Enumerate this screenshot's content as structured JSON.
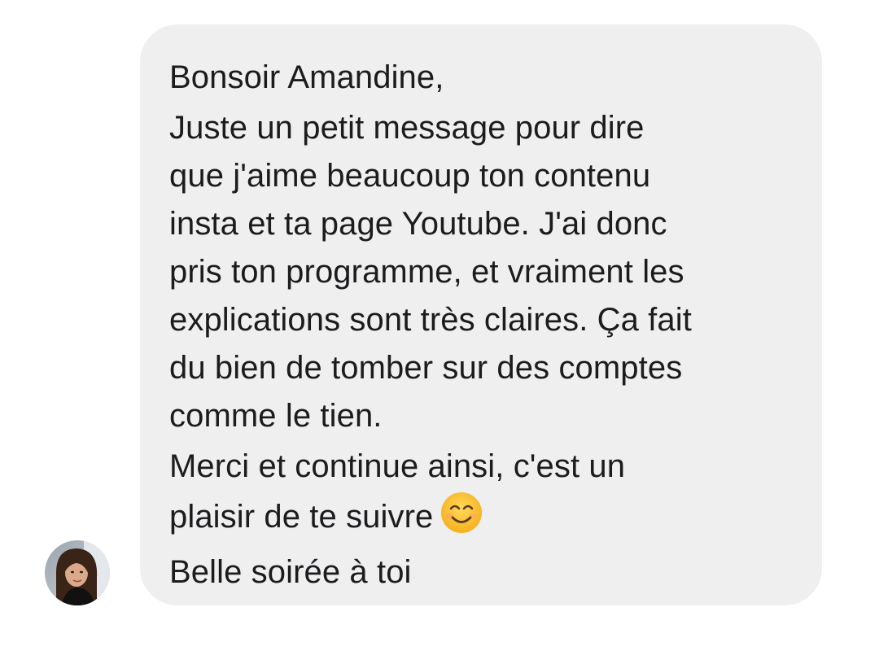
{
  "message": {
    "greeting": "Bonsoir Amandine,",
    "body_lines": [
      "Juste un petit message pour dire",
      "que j'aime beaucoup ton contenu",
      "insta et ta page Youtube. J'ai donc",
      "pris ton programme, et vraiment les",
      "explications sont très claires. Ça fait",
      "du bien de tomber sur des comptes",
      "comme le tien."
    ],
    "closing_lines": [
      "Merci et continue ainsi, c'est un",
      "plaisir de te suivre",
      "Belle soirée à toi"
    ],
    "emoji": "smiling-face-with-smiling-eyes-icon"
  },
  "colors": {
    "bubble_background": "#efeff0",
    "text": "#1c1c1e",
    "emoji_face": "#f7c12b"
  },
  "sender": {
    "avatar": "profile-photo"
  }
}
